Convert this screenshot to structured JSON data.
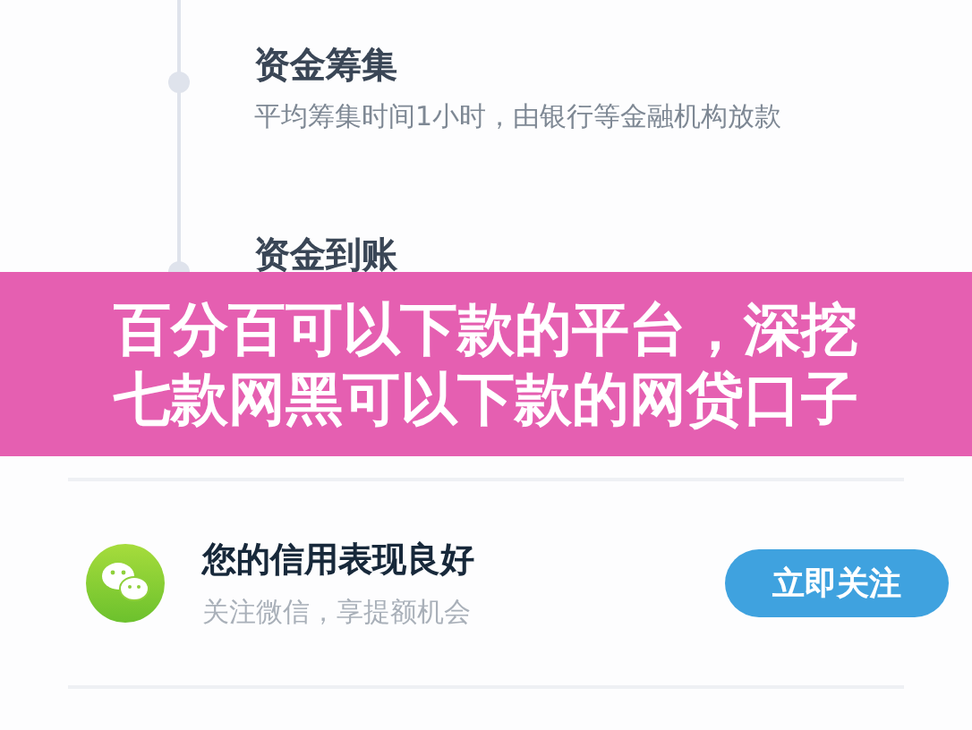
{
  "steps": [
    {
      "title": "资金筹集",
      "subtitle": "平均筹集时间1小时，由银行等金融机构放款"
    },
    {
      "title": "资金到账"
    }
  ],
  "banner": {
    "text": "百分百可以下款的平台，深挖七款网黑可以下款的网贷口子"
  },
  "follow_card": {
    "title": "您的信用表现良好",
    "subtitle": "关注微信，享提额机会",
    "button": "立即关注"
  }
}
